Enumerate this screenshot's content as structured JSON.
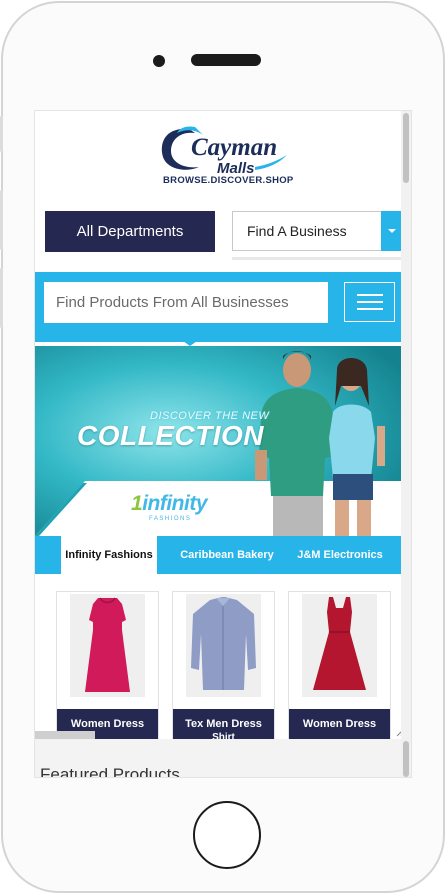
{
  "header": {
    "logo_word1": "Cayman",
    "logo_word2": "Malls",
    "tagline": "BROWSE.DISCOVER.SHOP"
  },
  "nav": {
    "departments_label": "All Departments",
    "business_select_value": "Find A Business"
  },
  "search": {
    "placeholder": "Find Products From All Businesses"
  },
  "banner": {
    "discover_text": "DISCOVER THE NEW",
    "collection_text": "COLLECTION",
    "brand_logo_text": "infinity",
    "brand_sub_text": "FASHIONS"
  },
  "tabs": [
    {
      "label": "Infinity Fashions",
      "active": true
    },
    {
      "label": "Caribbean Bakery",
      "active": false
    },
    {
      "label": "J&M Electronics",
      "active": false
    }
  ],
  "products": [
    {
      "label": "Women Dress",
      "sub": ""
    },
    {
      "label": "Tex Men Dress",
      "sub": "Shirt"
    },
    {
      "label": "Women Dress",
      "sub": ""
    }
  ],
  "featured": {
    "title": "Featured Products"
  },
  "colors": {
    "accent_blue": "#27b4e8",
    "navy": "#252850"
  }
}
